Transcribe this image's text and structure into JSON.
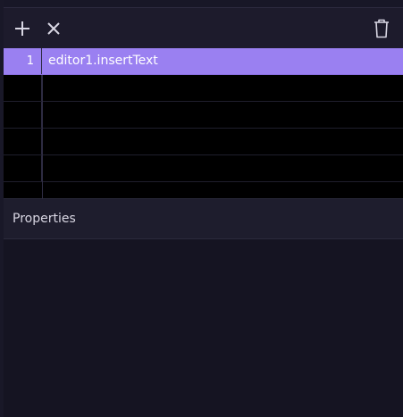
{
  "toolbar": {
    "add_icon": "plus-icon",
    "remove_icon": "close-icon",
    "delete_icon": "trash-icon"
  },
  "grid": {
    "rows": [
      {
        "num": "1",
        "text": "editor1.insertText",
        "selected": true
      },
      {
        "num": "",
        "text": ""
      },
      {
        "num": "",
        "text": ""
      },
      {
        "num": "",
        "text": ""
      },
      {
        "num": "",
        "text": ""
      }
    ]
  },
  "properties": {
    "title": "Properties"
  },
  "colors": {
    "selection": "#9a80f1",
    "background": "#14131e",
    "grid_background": "#000000"
  }
}
